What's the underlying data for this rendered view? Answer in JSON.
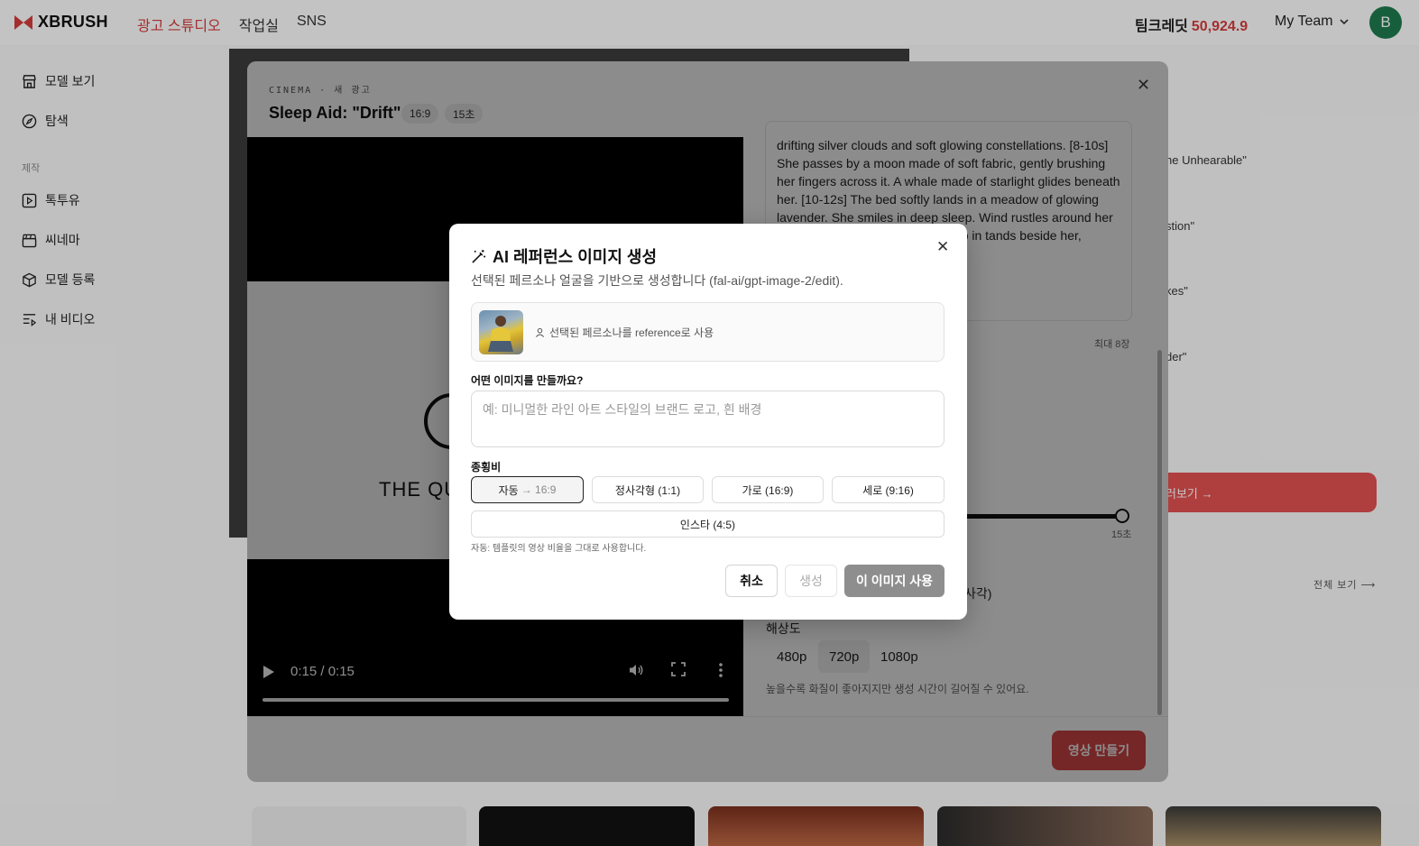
{
  "topbar": {
    "brand": "XBRUSH",
    "nav": [
      "광고 스튜디오",
      "작업실",
      "SNS"
    ],
    "credits_label": "팀크레딧",
    "credits_value": "50,924.9",
    "team": "My Team",
    "avatar_initial": "B",
    "accent_color": "#d23c3c"
  },
  "sidebar": {
    "items_top": [
      {
        "label": "모델 보기",
        "icon": "store-icon"
      },
      {
        "label": "탐색",
        "icon": "compass-icon"
      }
    ],
    "section_label": "제작",
    "items_make": [
      {
        "label": "톡투유",
        "icon": "play-square-icon"
      },
      {
        "label": "씨네마",
        "icon": "clapperboard-icon"
      },
      {
        "label": "모델 등록",
        "icon": "package-icon"
      },
      {
        "label": "내 비디오",
        "icon": "list-video-icon"
      }
    ]
  },
  "background": {
    "right_snippets": [
      "he Unhearable\"",
      "stion\"",
      "kes\"",
      "der\""
    ],
    "red_button_label": "러보기 →",
    "view_all": "전체 보기 ⟶",
    "partial_text": "사각)"
  },
  "cinema": {
    "kicker": "CINEMA · 새 광고",
    "title": "Sleep Aid: \"Drift\"",
    "pills": [
      "16:9",
      "15초"
    ],
    "video_overlay_text": "THE QU",
    "video_time": "0:15 / 0:15",
    "script": "drifting silver clouds and soft glowing constellations. [8-10s] She passes by a moon made of soft fabric, gently brushing her fingers across it. A whale made of starlight glides beneath her. [10-12s] The bed softly lands in a meadow of glowing lavender. She smiles in deep sleep. Wind rustles around her sleeping face. ight begins to creep in tands beside her, glowing en script. Tagline: \"THE",
    "max_label": "최대 8장",
    "duration_end": "15초",
    "resolution_label": "해상도",
    "resolutions": [
      "480p",
      "720p",
      "1080p"
    ],
    "resolution_selected": "720p",
    "resolution_note": "높을수록 화질이 좋아지지만 생성 시간이 길어질 수 있어요.",
    "make_video": "영상 만들기"
  },
  "dialog": {
    "title": "AI 레퍼런스 이미지 생성",
    "subtitle": "선택된 페르소나 얼굴을 기반으로 생성합니다 (fal-ai/gpt-image-2/edit).",
    "persona_label": "선택된 페르소나를 reference로 사용",
    "prompt_label": "어떤 이미지를 만들까요?",
    "prompt_placeholder": "예: 미니멀한 라인 아트 스타일의 브랜드 로고, 흰 배경",
    "prompt_value": "",
    "ratio_label": "종횡비",
    "ratios": [
      "자동",
      "정사각형 (1:1)",
      "가로 (16:9)",
      "세로 (9:16)",
      "인스타 (4:5)"
    ],
    "auto_suffix": "→ 16:9",
    "ratio_selected": "자동",
    "ratio_note": "자동: 템플릿의 영상 비율을 그대로 사용합니다.",
    "cancel": "취소",
    "generate": "생성",
    "use_image": "이 이미지 사용"
  }
}
